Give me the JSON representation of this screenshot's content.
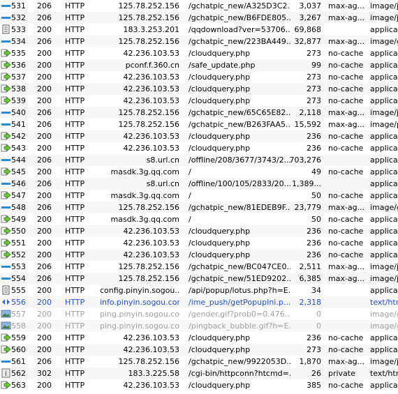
{
  "sessions": [
    {
      "num": "531",
      "result": "206",
      "protocol": "HTTP",
      "host": "125.78.252.156",
      "url": "/gchatpic_new/A325D3C2...",
      "body": "3,037",
      "caching": "max-ag...",
      "ctype": "image/jp",
      "icon": "response-icon",
      "state": "normal"
    },
    {
      "num": "532",
      "result": "206",
      "protocol": "HTTP",
      "host": "125.78.252.156",
      "url": "/gchatpic_new/B6FDE805...",
      "body": "3,267",
      "caching": "max-ag...",
      "ctype": "image/jp",
      "icon": "response-icon",
      "state": "normal"
    },
    {
      "num": "533",
      "result": "200",
      "protocol": "HTTP",
      "host": "183.3.253.201",
      "url": "/qqdownload?ver=53706...",
      "body": "69,868",
      "caching": "",
      "ctype": "applicati",
      "icon": "document-icon",
      "state": "normal"
    },
    {
      "num": "534",
      "result": "206",
      "protocol": "HTTP",
      "host": "125.78.252.156",
      "url": "/gchatpic_new/223BA449...",
      "body": "32,877",
      "caching": "max-ag...",
      "ctype": "image/gi",
      "icon": "response-icon",
      "state": "normal"
    },
    {
      "num": "535",
      "result": "200",
      "protocol": "HTTP",
      "host": "42.236.103.53",
      "url": "/cloudquery.php",
      "body": "273",
      "caching": "no-cache",
      "ctype": "applicati",
      "icon": "post-icon",
      "state": "normal"
    },
    {
      "num": "536",
      "result": "200",
      "protocol": "HTTP",
      "host": "pconf.f.360.cn",
      "url": "/safe_update.php",
      "body": "99",
      "caching": "no-cache",
      "ctype": "applicati",
      "icon": "post-icon",
      "state": "normal"
    },
    {
      "num": "537",
      "result": "200",
      "protocol": "HTTP",
      "host": "42.236.103.53",
      "url": "/cloudquery.php",
      "body": "273",
      "caching": "no-cache",
      "ctype": "applicati",
      "icon": "post-icon",
      "state": "normal"
    },
    {
      "num": "538",
      "result": "200",
      "protocol": "HTTP",
      "host": "42.236.103.53",
      "url": "/cloudquery.php",
      "body": "273",
      "caching": "no-cache",
      "ctype": "applicati",
      "icon": "post-icon",
      "state": "normal"
    },
    {
      "num": "539",
      "result": "200",
      "protocol": "HTTP",
      "host": "42.236.103.53",
      "url": "/cloudquery.php",
      "body": "273",
      "caching": "no-cache",
      "ctype": "applicati",
      "icon": "post-icon",
      "state": "normal"
    },
    {
      "num": "540",
      "result": "206",
      "protocol": "HTTP",
      "host": "125.78.252.156",
      "url": "/gchatpic_new/65C65E82...",
      "body": "2,118",
      "caching": "max-ag...",
      "ctype": "image/jp",
      "icon": "response-icon",
      "state": "normal"
    },
    {
      "num": "541",
      "result": "206",
      "protocol": "HTTP",
      "host": "125.78.252.156",
      "url": "/gchatpic_new/B263FAA5...",
      "body": "15,592",
      "caching": "max-ag...",
      "ctype": "image/pi",
      "icon": "response-icon",
      "state": "normal"
    },
    {
      "num": "542",
      "result": "200",
      "protocol": "HTTP",
      "host": "42.236.103.53",
      "url": "/cloudquery.php",
      "body": "236",
      "caching": "no-cache",
      "ctype": "applicati",
      "icon": "post-icon",
      "state": "normal"
    },
    {
      "num": "543",
      "result": "200",
      "protocol": "HTTP",
      "host": "42.236.103.53",
      "url": "/cloudquery.php",
      "body": "236",
      "caching": "no-cache",
      "ctype": "applicati",
      "icon": "post-icon",
      "state": "normal"
    },
    {
      "num": "544",
      "result": "206",
      "protocol": "HTTP",
      "host": "s8.url.cn",
      "url": "/offline/208/3677/3743/2...",
      "body": "703,276",
      "caching": "",
      "ctype": "applicati",
      "icon": "response-icon",
      "state": "normal"
    },
    {
      "num": "545",
      "result": "200",
      "protocol": "HTTP",
      "host": "masdk.3g.qq.com",
      "url": "/",
      "body": "49",
      "caching": "no-cache",
      "ctype": "applicati",
      "icon": "post-icon",
      "state": "normal"
    },
    {
      "num": "546",
      "result": "206",
      "protocol": "HTTP",
      "host": "s8.url.cn",
      "url": "/offline/100/105/2833/20...",
      "body": "1,389...",
      "caching": "",
      "ctype": "applicati",
      "icon": "response-icon",
      "state": "normal"
    },
    {
      "num": "547",
      "result": "200",
      "protocol": "HTTP",
      "host": "masdk.3g.qq.com",
      "url": "/",
      "body": "50",
      "caching": "no-cache",
      "ctype": "applicati",
      "icon": "post-icon",
      "state": "normal"
    },
    {
      "num": "548",
      "result": "206",
      "protocol": "HTTP",
      "host": "125.78.252.156",
      "url": "/gchatpic_new/81EDEB9F...",
      "body": "23,779",
      "caching": "max-ag...",
      "ctype": "image/gi",
      "icon": "response-icon",
      "state": "normal"
    },
    {
      "num": "549",
      "result": "200",
      "protocol": "HTTP",
      "host": "masdk.3g.qq.com",
      "url": "/",
      "body": "50",
      "caching": "no-cache",
      "ctype": "applicati",
      "icon": "post-icon",
      "state": "normal"
    },
    {
      "num": "550",
      "result": "200",
      "protocol": "HTTP",
      "host": "42.236.103.53",
      "url": "/cloudquery.php",
      "body": "236",
      "caching": "no-cache",
      "ctype": "applicati",
      "icon": "post-icon",
      "state": "normal"
    },
    {
      "num": "551",
      "result": "200",
      "protocol": "HTTP",
      "host": "42.236.103.53",
      "url": "/cloudquery.php",
      "body": "236",
      "caching": "no-cache",
      "ctype": "applicati",
      "icon": "post-icon",
      "state": "normal"
    },
    {
      "num": "552",
      "result": "200",
      "protocol": "HTTP",
      "host": "42.236.103.53",
      "url": "/cloudquery.php",
      "body": "236",
      "caching": "no-cache",
      "ctype": "applicati",
      "icon": "post-icon",
      "state": "normal"
    },
    {
      "num": "553",
      "result": "206",
      "protocol": "HTTP",
      "host": "125.78.252.156",
      "url": "/gchatpic_new/BC047CE0...",
      "body": "2,511",
      "caching": "max-ag...",
      "ctype": "image/jp",
      "icon": "response-icon",
      "state": "normal"
    },
    {
      "num": "554",
      "result": "206",
      "protocol": "HTTP",
      "host": "125.78.252.156",
      "url": "/gchatpic_new/51ED9202...",
      "body": "6,385",
      "caching": "max-ag...",
      "ctype": "image/jp",
      "icon": "response-icon",
      "state": "normal"
    },
    {
      "num": "555",
      "result": "200",
      "protocol": "HTTP",
      "host": "config.pinyin.sogou....",
      "url": "/api/popup/lotus.php?h=E...",
      "body": "34",
      "caching": "",
      "ctype": "applicati",
      "icon": "document-icon",
      "state": "normal"
    },
    {
      "num": "556",
      "result": "200",
      "protocol": "HTTP",
      "host": "info.pinyin.sogou.com",
      "url": "/ime_push/getPopupIni.p...",
      "body": "2,318",
      "caching": "",
      "ctype": "text/htm",
      "icon": "html-icon",
      "state": "sel"
    },
    {
      "num": "557",
      "result": "200",
      "protocol": "HTTP",
      "host": "ping.pinyin.sogou.com",
      "url": "/gender.gif?prob0=0.476...",
      "body": "0",
      "caching": "",
      "ctype": "image/gi",
      "icon": "image-icon",
      "state": "dim"
    },
    {
      "num": "558",
      "result": "200",
      "protocol": "HTTP",
      "host": "ping.pinyin.sogou.com",
      "url": "/pingback_bubble.gif?h=E...",
      "body": "0",
      "caching": "",
      "ctype": "image/gi",
      "icon": "image-icon",
      "state": "dim"
    },
    {
      "num": "559",
      "result": "200",
      "protocol": "HTTP",
      "host": "42.236.103.53",
      "url": "/cloudquery.php",
      "body": "236",
      "caching": "no-cache",
      "ctype": "applicati",
      "icon": "post-icon",
      "state": "normal"
    },
    {
      "num": "560",
      "result": "200",
      "protocol": "HTTP",
      "host": "42.236.103.53",
      "url": "/cloudquery.php",
      "body": "273",
      "caching": "no-cache",
      "ctype": "applicati",
      "icon": "post-icon",
      "state": "normal"
    },
    {
      "num": "561",
      "result": "206",
      "protocol": "HTTP",
      "host": "125.78.252.156",
      "url": "/gchatpic_new/9922053D...",
      "body": "1,870",
      "caching": "max-ag...",
      "ctype": "image/jp",
      "icon": "response-icon",
      "state": "normal"
    },
    {
      "num": "562",
      "result": "302",
      "protocol": "HTTP",
      "host": "183.3.225.58",
      "url": "/cgi-bin/httpconn?htcmd=...",
      "body": "26",
      "caching": "private",
      "ctype": "text/htm",
      "icon": "info-icon",
      "state": "normal"
    },
    {
      "num": "563",
      "result": "200",
      "protocol": "HTTP",
      "host": "42.236.103.53",
      "url": "/cloudquery.php",
      "body": "385",
      "caching": "no-cache",
      "ctype": "applicati",
      "icon": "post-icon",
      "state": "normal"
    }
  ],
  "icon_colors": {
    "response": "#2a8bd4",
    "post_fill": "#72c442",
    "post_stroke": "#2f7a17",
    "document": "#555555",
    "html_fill": "#3a66d6",
    "image_fill": "#8fb5dc",
    "info_fill": "#e8e8e8"
  }
}
